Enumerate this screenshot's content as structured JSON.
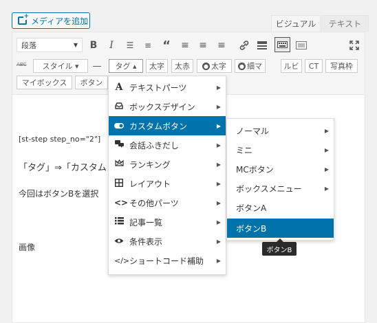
{
  "header": {
    "media_button": "メディアを追加",
    "tab_visual": "ビジュアル",
    "tab_text": "テキスト"
  },
  "toolbar": {
    "format_select": "段落",
    "row2": [
      "スタイル ▾",
      "—",
      "タグ ▴",
      "太字",
      "太赤",
      "太字",
      "細マ",
      "ルビ",
      "CT",
      "写真枠"
    ],
    "row2_icons": [
      "abc-strike-icon",
      "user-icon",
      "user-icon"
    ],
    "row3": [
      "マイボックス",
      "ボタン"
    ]
  },
  "content": {
    "line1": "[st-step step_no=\"2\"]",
    "line2": "「タグ」⇒「カスタム",
    "line3": "今回はボタンBを選択",
    "line4": "画像"
  },
  "tag_menu": {
    "items": [
      {
        "label": "テキストパーツ",
        "icon": "letter-a-icon"
      },
      {
        "label": "ボックスデザイン",
        "icon": "inbox-icon"
      },
      {
        "label": "カスタムボタン",
        "icon": "toggle-icon"
      },
      {
        "label": "会話ふきだし",
        "icon": "speech-bubble-icon"
      },
      {
        "label": "ランキング",
        "icon": "crown-icon"
      },
      {
        "label": "レイアウト",
        "icon": "grid-icon"
      },
      {
        "label": "その他パーツ",
        "icon": "code-icon"
      },
      {
        "label": "記事一覧",
        "icon": "list-icon"
      },
      {
        "label": "条件表示",
        "icon": "eye-icon"
      },
      {
        "label": "ショートコード補助",
        "icon": "shortcode-icon"
      }
    ]
  },
  "button_menu": {
    "items": [
      {
        "label": "ノーマル"
      },
      {
        "label": "ミニ"
      },
      {
        "label": "MCボタン"
      },
      {
        "label": "ボックスメニュー"
      },
      {
        "label": "ボタンA"
      },
      {
        "label": "ボタンB"
      }
    ]
  },
  "tooltip": "ボタンB",
  "colors": {
    "accent": "#0073aa"
  }
}
